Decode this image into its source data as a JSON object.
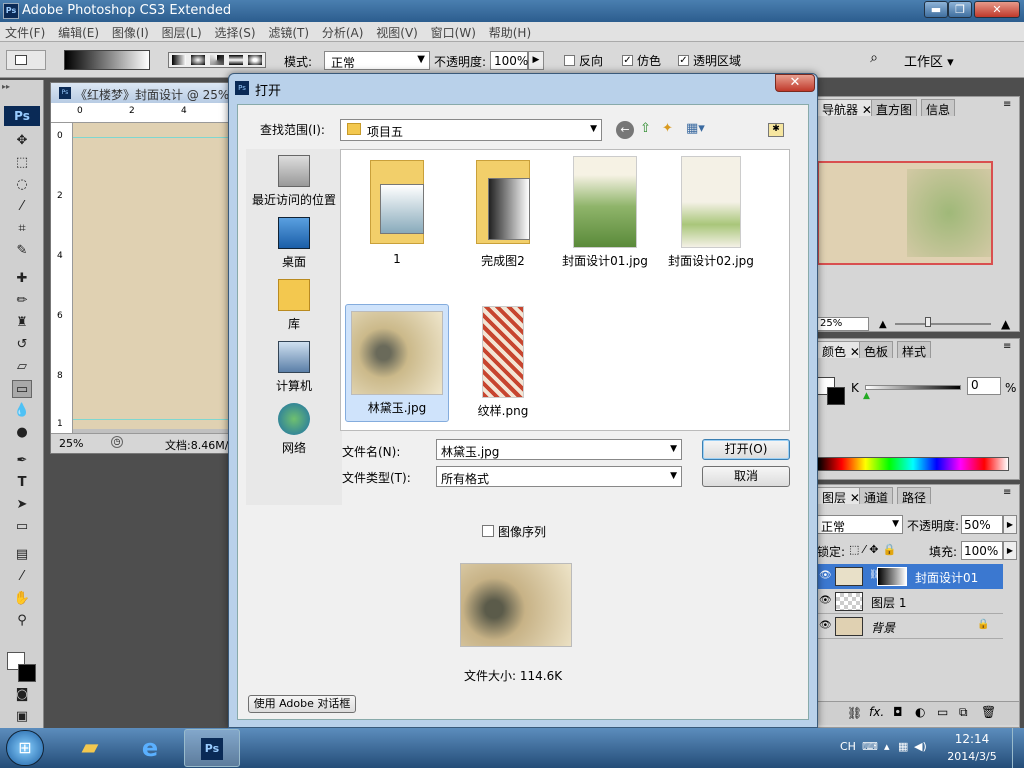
{
  "window": {
    "title": "Adobe Photoshop CS3 Extended",
    "min": "▬",
    "max": "❐",
    "close": "✕"
  },
  "menu": [
    "文件(F)",
    "编辑(E)",
    "图像(I)",
    "图层(L)",
    "选择(S)",
    "滤镜(T)",
    "分析(A)",
    "视图(V)",
    "窗口(W)",
    "帮助(H)"
  ],
  "options": {
    "mode_label": "模式:",
    "mode_value": "正常",
    "opacity_label": "不透明度:",
    "opacity_value": "100%",
    "reverse": "反向",
    "dither": "仿色",
    "transparency": "透明区域",
    "workspace": "工作区 ▾"
  },
  "document": {
    "title": "《红楼梦》封面设计 @ 25%",
    "zoom": "25%",
    "info": "文档:8.46M/",
    "ruler_h": [
      "0",
      "2",
      "4"
    ],
    "ruler_v": [
      "0",
      "2",
      "4",
      "6",
      "8",
      "1"
    ]
  },
  "panels": {
    "nav_tabs": [
      "导航器",
      "直方图",
      "信息"
    ],
    "nav_zoom": "25%",
    "color_tabs": [
      "颜色",
      "色板",
      "样式"
    ],
    "color_k_label": "K",
    "color_k_value": "0",
    "color_k_unit": "%",
    "layers_tabs": [
      "图层",
      "通道",
      "路径"
    ],
    "blend_mode": "正常",
    "opacity_label": "不透明度:",
    "opacity_value": "50%",
    "lock_label": "锁定:",
    "fill_label": "填充:",
    "fill_value": "100%",
    "layers": [
      {
        "name": "封面设计01"
      },
      {
        "name": "图层 1"
      },
      {
        "name": "背景"
      }
    ]
  },
  "dialog": {
    "title": "打开",
    "lookin_label": "查找范围(I):",
    "lookin_value": "项目五",
    "places": [
      "最近访问的位置",
      "桌面",
      "库",
      "计算机",
      "网络"
    ],
    "files": [
      {
        "name": "1"
      },
      {
        "name": "完成图2"
      },
      {
        "name": "封面设计01.jpg"
      },
      {
        "name": "封面设计02.jpg"
      },
      {
        "name": "林黛玉.jpg"
      },
      {
        "name": "纹样.png"
      }
    ],
    "filename_label": "文件名(N):",
    "filename_value": "林黛玉.jpg",
    "filetype_label": "文件类型(T):",
    "filetype_value": "所有格式",
    "open_button": "打开(O)",
    "cancel_button": "取消",
    "sequence_label": "图像序列",
    "filesize": "文件大小: 114.6K",
    "adobe_dialog_button": "使用 Adobe 对话框"
  },
  "taskbar": {
    "lang": "CH",
    "time": "12:14",
    "date": "2014/3/5"
  }
}
